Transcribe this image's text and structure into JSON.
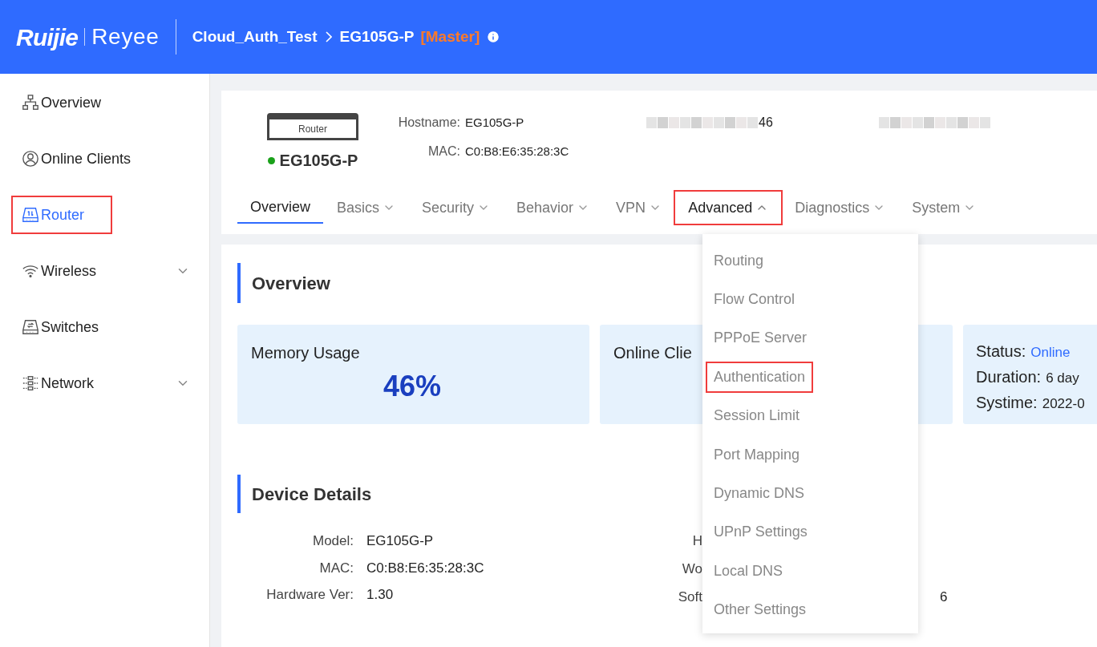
{
  "header": {
    "logo": "Ruijie",
    "sub_logo": "Reyee",
    "breadcrumb": [
      {
        "label": "Cloud_Auth_Test"
      },
      {
        "label": "EG105G-P"
      }
    ],
    "role": "[Master]"
  },
  "sidebar": {
    "items": [
      {
        "label": "Overview",
        "kind": "topology",
        "selected": false,
        "annotated": false,
        "expandable": false
      },
      {
        "label": "Online Clients",
        "kind": "user",
        "selected": false,
        "annotated": false,
        "expandable": false
      },
      {
        "label": "Router",
        "kind": "router",
        "selected": true,
        "annotated": true,
        "expandable": false
      },
      {
        "label": "Wireless",
        "kind": "wifi",
        "selected": false,
        "annotated": false,
        "expandable": true
      },
      {
        "label": "Switches",
        "kind": "switch",
        "selected": false,
        "annotated": false,
        "expandable": false
      },
      {
        "label": "Network",
        "kind": "network",
        "selected": false,
        "annotated": false,
        "expandable": true
      }
    ]
  },
  "device": {
    "image_label": "Router",
    "name": "EG105G-P",
    "online": true,
    "fields": [
      {
        "label": "Hostname:",
        "value": "EG105G-P"
      },
      {
        "label": "MAC:",
        "value": "C0:B8:E6:35:28:3C"
      }
    ],
    "blurred_tail": "46"
  },
  "tabs": [
    {
      "label": "Overview",
      "selected": true,
      "dropdown": false,
      "open": false,
      "annotated": false
    },
    {
      "label": "Basics",
      "selected": false,
      "dropdown": true,
      "open": false,
      "annotated": false
    },
    {
      "label": "Security",
      "selected": false,
      "dropdown": true,
      "open": false,
      "annotated": false
    },
    {
      "label": "Behavior",
      "selected": false,
      "dropdown": true,
      "open": false,
      "annotated": false
    },
    {
      "label": "VPN",
      "selected": false,
      "dropdown": true,
      "open": false,
      "annotated": false
    },
    {
      "label": "Advanced",
      "selected": false,
      "dropdown": true,
      "open": true,
      "annotated": true
    },
    {
      "label": "Diagnostics",
      "selected": false,
      "dropdown": true,
      "open": false,
      "annotated": false
    },
    {
      "label": "System",
      "selected": false,
      "dropdown": true,
      "open": false,
      "annotated": false
    }
  ],
  "dropdown_menu": [
    {
      "label": "Routing",
      "annotated": false
    },
    {
      "label": "Flow Control",
      "annotated": false
    },
    {
      "label": "PPPoE Server",
      "annotated": false
    },
    {
      "label": "Authentication",
      "annotated": true
    },
    {
      "label": "Session Limit",
      "annotated": false
    },
    {
      "label": "Port Mapping",
      "annotated": false
    },
    {
      "label": "Dynamic DNS",
      "annotated": false
    },
    {
      "label": "UPnP Settings",
      "annotated": false
    },
    {
      "label": "Local DNS",
      "annotated": false
    },
    {
      "label": "Other Settings",
      "annotated": false
    }
  ],
  "overview": {
    "title": "Overview",
    "memory": {
      "label": "Memory Usage",
      "value": "46%"
    },
    "clients": {
      "label": "Online Clie"
    },
    "status": [
      {
        "label": "Status:",
        "value": "Online",
        "kind": "link"
      },
      {
        "label": "Duration:",
        "value": "6 day",
        "kind": "text"
      },
      {
        "label": "Systime:",
        "value": "2022-0",
        "kind": "text"
      }
    ]
  },
  "device_details": {
    "title": "Device Details",
    "left": [
      {
        "label": "Model:",
        "value": "EG105G-P"
      },
      {
        "label": "MAC:",
        "value": "C0:B8:E6:35:28:3C"
      },
      {
        "label": "Hardware Ver:",
        "value": "1.30"
      }
    ],
    "right": [
      {
        "label": "H"
      },
      {
        "label": "Wo"
      },
      {
        "label": "Soft",
        "tail": "6"
      }
    ]
  }
}
